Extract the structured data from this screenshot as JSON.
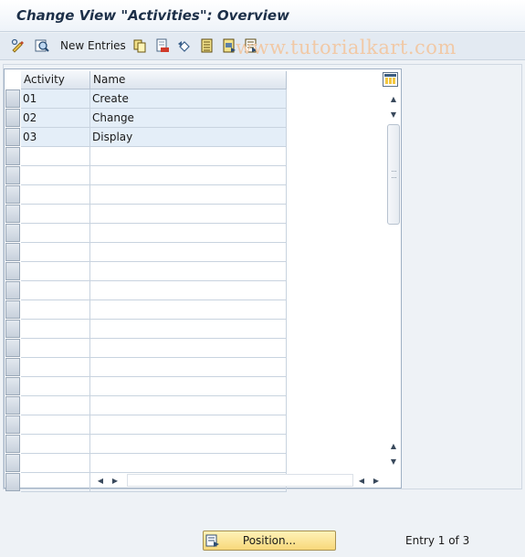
{
  "title": "Change View \"Activities\": Overview",
  "toolbar": {
    "new_entries_label": "New Entries",
    "icons": [
      "display-change-icon",
      "details-icon",
      "copy-icon",
      "delete-icon",
      "undo-icon",
      "select-all-icon",
      "select-block-icon",
      "deselect-all-icon"
    ]
  },
  "watermark": "www.tutorialkart.com",
  "table": {
    "columns": [
      "Activity",
      "Name"
    ],
    "rows": [
      {
        "activity": "01",
        "name": "Create"
      },
      {
        "activity": "02",
        "name": "Change"
      },
      {
        "activity": "03",
        "name": "Display"
      }
    ]
  },
  "footer": {
    "position_button_label": "Position...",
    "entry_text": "Entry 1 of 3"
  },
  "colors": {
    "title": "#1c2f48",
    "filled_row": "#e4eef8",
    "button": "#f7d87a",
    "watermark": "#f1c9a6"
  }
}
